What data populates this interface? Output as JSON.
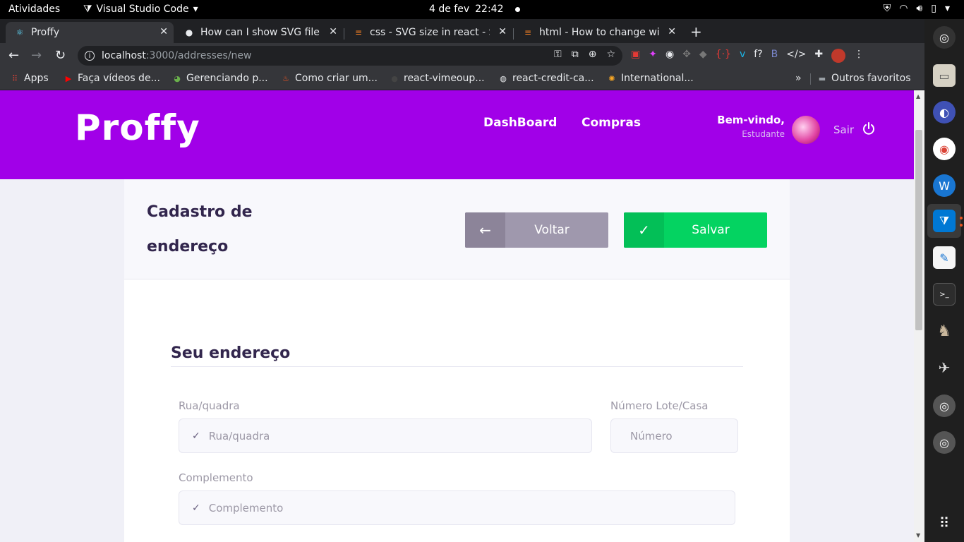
{
  "system": {
    "activities": "Atividades",
    "app_menu": "Visual Studio Code",
    "date": "4 de fev",
    "time": "22:42"
  },
  "tabs": [
    {
      "title": "Proffy",
      "icon": "react-icon"
    },
    {
      "title": "How can I show SVG file o",
      "icon": "github-icon"
    },
    {
      "title": "css - SVG size in react - Sta",
      "icon": "stackoverflow-icon"
    },
    {
      "title": "html - How to change wid",
      "icon": "stackoverflow-icon"
    }
  ],
  "toolbar": {
    "url_host": "localhost",
    "url_path": ":3000/addresses/new"
  },
  "bookmarks": {
    "apps": "Apps",
    "items": [
      "Faça vídeos de...",
      "Gerenciando p...",
      "Como criar um...",
      "react-vimeoup...",
      "react-credit-ca...",
      "International..."
    ],
    "more": "»",
    "other": "Outros favoritos"
  },
  "header": {
    "logo": "Proffy",
    "nav": [
      "DashBoard",
      "Compras"
    ],
    "welcome": "Bem-vindo,",
    "role": "Estudante",
    "logout": "Sair"
  },
  "form": {
    "title": "Cadastro de endereço",
    "back_label": "Voltar",
    "save_label": "Salvar",
    "section_title": "Seu endereço",
    "street_label": "Rua/quadra",
    "street_placeholder": "Rua/quadra",
    "number_label": "Número Lote/Casa",
    "number_placeholder": "Número",
    "complement_label": "Complemento",
    "complement_placeholder": "Complemento"
  },
  "colors": {
    "brand": "#a100e8",
    "success": "#04d361",
    "muted_button": "#9f98ad",
    "title_text": "#32264d"
  }
}
